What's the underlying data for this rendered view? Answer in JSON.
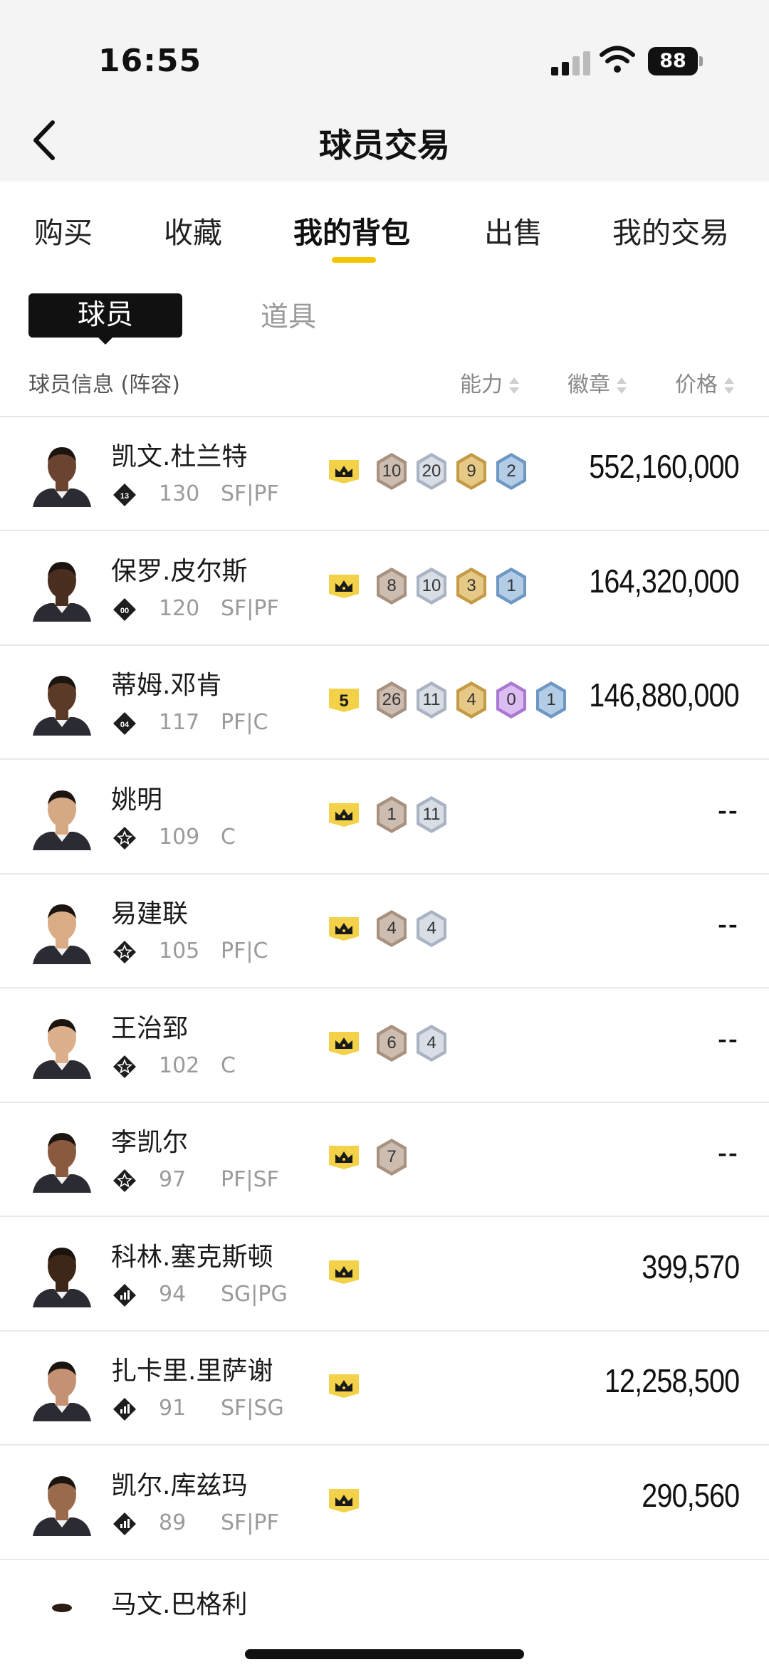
{
  "status_bar": {
    "time": "16:55",
    "battery": "88"
  },
  "header": {
    "title": "球员交易",
    "back_icon": "chevron-left-icon"
  },
  "tabs": [
    {
      "label": "购买",
      "active": false
    },
    {
      "label": "收藏",
      "active": false
    },
    {
      "label": "我的背包",
      "active": true
    },
    {
      "label": "出售",
      "active": false
    },
    {
      "label": "我的交易",
      "active": false
    }
  ],
  "subtabs": [
    {
      "label": "球员",
      "active": true
    },
    {
      "label": "道具",
      "active": false
    }
  ],
  "columns": {
    "info": "球员信息 (阵容)",
    "ability": "能力",
    "badges": "徽章",
    "price": "价格"
  },
  "colors": {
    "accent": "#f5c400",
    "crown_bg": "#f3d24a",
    "badge_bronze": "#b9a79a",
    "badge_silver": "#c3cad6",
    "badge_gold": "#d9b35e",
    "badge_purple": "#c39be0",
    "badge_blue": "#8fb3d6"
  },
  "players": [
    {
      "name": "凯文.杜兰特",
      "rank_label": "13",
      "rating": "130",
      "position": "SF|PF",
      "crown": "",
      "badges": [
        {
          "v": "10",
          "c": "bronze"
        },
        {
          "v": "20",
          "c": "silver"
        },
        {
          "v": "9",
          "c": "gold"
        },
        {
          "v": "2",
          "c": "blue"
        }
      ],
      "price": "552,160,000"
    },
    {
      "name": "保罗.皮尔斯",
      "rank_label": "00",
      "rating": "120",
      "position": "SF|PF",
      "crown": "",
      "badges": [
        {
          "v": "8",
          "c": "bronze"
        },
        {
          "v": "10",
          "c": "silver"
        },
        {
          "v": "3",
          "c": "gold"
        },
        {
          "v": "1",
          "c": "blue"
        }
      ],
      "price": "164,320,000"
    },
    {
      "name": "蒂姆.邓肯",
      "rank_label": "04",
      "rating": "117",
      "position": "PF|C",
      "crown": "5",
      "badges": [
        {
          "v": "26",
          "c": "bronze"
        },
        {
          "v": "11",
          "c": "silver"
        },
        {
          "v": "4",
          "c": "gold"
        },
        {
          "v": "0",
          "c": "purple"
        },
        {
          "v": "1",
          "c": "blue"
        }
      ],
      "price": "146,880,000"
    },
    {
      "name": "姚明",
      "rank_label": "",
      "rating": "109",
      "position": "C",
      "crown": "",
      "badges": [
        {
          "v": "1",
          "c": "bronze"
        },
        {
          "v": "11",
          "c": "silver"
        }
      ],
      "price": "--"
    },
    {
      "name": "易建联",
      "rank_label": "",
      "rating": "105",
      "position": "PF|C",
      "crown": "",
      "badges": [
        {
          "v": "4",
          "c": "bronze"
        },
        {
          "v": "4",
          "c": "silver"
        }
      ],
      "price": "--"
    },
    {
      "name": "王治郅",
      "rank_label": "",
      "rating": "102",
      "position": "C",
      "crown": "",
      "badges": [
        {
          "v": "6",
          "c": "bronze"
        },
        {
          "v": "4",
          "c": "silver"
        }
      ],
      "price": "--"
    },
    {
      "name": "李凯尔",
      "rank_label": "",
      "rating": "97",
      "position": "PF|SF",
      "crown": "",
      "badges": [
        {
          "v": "7",
          "c": "bronze"
        }
      ],
      "price": "--"
    },
    {
      "name": "科林.塞克斯顿",
      "rank_label": "",
      "rating": "94",
      "position": "SG|PG",
      "crown": "",
      "badges": [],
      "price": "399,570"
    },
    {
      "name": "扎卡里.里萨谢",
      "rank_label": "",
      "rating": "91",
      "position": "SF|SG",
      "crown": "",
      "badges": [],
      "price": "12,258,500"
    },
    {
      "name": "凯尔.库兹玛",
      "rank_label": "",
      "rating": "89",
      "position": "SF|PF",
      "crown": "",
      "badges": [],
      "price": "290,560"
    }
  ],
  "partial_row": {
    "name": "马文.巴格利"
  }
}
